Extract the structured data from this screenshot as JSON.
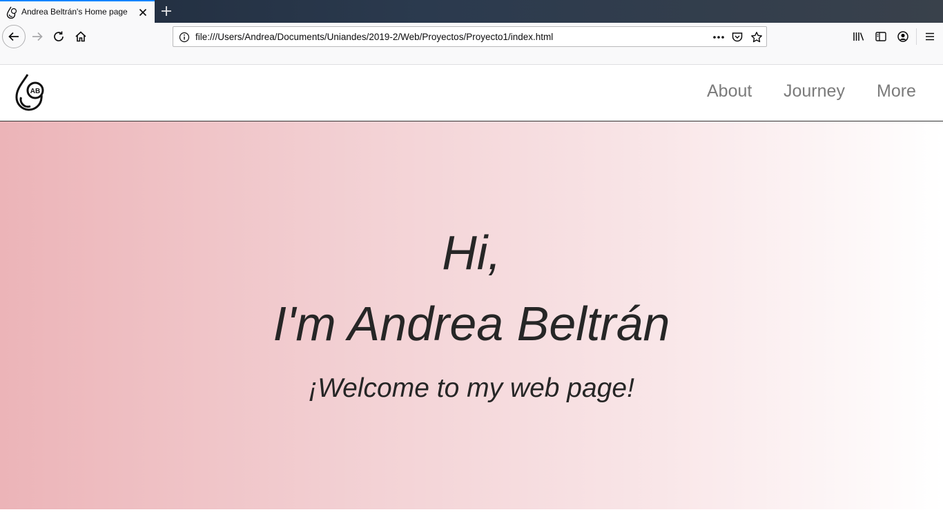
{
  "browser": {
    "tab_title": "Andrea Beltrán's Home page",
    "url": "file:///Users/Andrea/Documents/Uniandes/2019-2/Web/Proyectos/Proyecto1/index.html",
    "accent_color": "#0a84ff"
  },
  "site": {
    "logo_text": "AB",
    "nav": {
      "about": "About",
      "journey": "Journey",
      "more": "More"
    }
  },
  "hero": {
    "greeting": "Hi,",
    "name_line": "I'm Andrea Beltrán",
    "welcome": "¡Welcome to my web page!",
    "gradient_start": "#ecb4b8",
    "gradient_end": "#ffffff"
  },
  "icons": {
    "tab_favicon": "drop-logo-icon",
    "tab_close": "close-icon",
    "new_tab": "plus-icon",
    "back": "arrow-left-icon",
    "forward": "arrow-right-icon",
    "reload": "reload-icon",
    "home": "home-icon",
    "info": "info-icon",
    "page_actions": "more-horizontal-icon",
    "pocket": "pocket-icon",
    "bookmark": "star-icon",
    "library": "library-icon",
    "sidebar": "sidebar-icon",
    "account": "account-icon",
    "menu": "hamburger-menu-icon"
  }
}
